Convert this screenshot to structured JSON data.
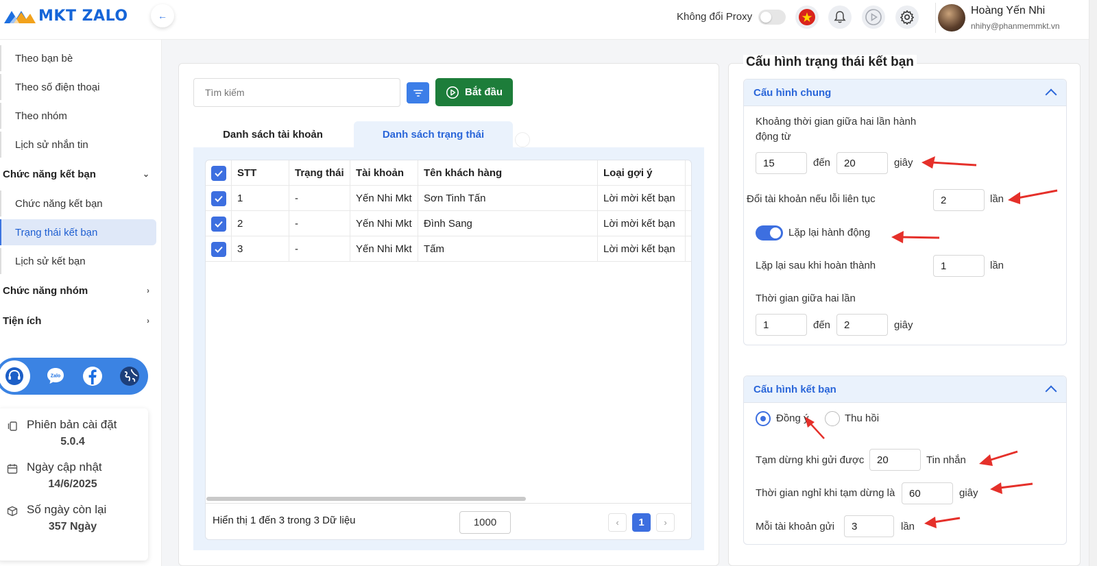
{
  "app": {
    "logo_text": "MKT ZALO"
  },
  "header": {
    "proxy_label": "Không đổi Proxy",
    "user_name": "Hoàng Yến Nhi",
    "user_email": "nhihy@phanmemmkt.vn",
    "icons": [
      "vietnam-flag-icon",
      "bell-icon",
      "play-icon",
      "gear-icon"
    ]
  },
  "sidebar": {
    "items_top": [
      "Theo bạn bè",
      "Theo số điện thoại",
      "Theo nhóm",
      "Lịch sử nhắn tin"
    ],
    "group_friend": "Chức năng kết bạn",
    "items_friend": [
      "Chức năng kết bạn",
      "Trạng thái kết bạn",
      "Lịch sử kết bạn"
    ],
    "active_item": "Trạng thái kết bạn",
    "group_group": "Chức năng nhóm",
    "group_util": "Tiện ích",
    "info": {
      "version_label": "Phiên bản cài đặt",
      "version_value": "5.0.4",
      "update_label": "Ngày cập nhật",
      "update_value": "14/6/2025",
      "days_label": "Số ngày còn lại",
      "days_value": "357 Ngày"
    }
  },
  "main": {
    "search_placeholder": "Tìm kiếm",
    "start_label": "Bắt đầu",
    "tabs": [
      "Danh sách tài khoản",
      "Danh sách trạng thái"
    ],
    "active_tab": "Danh sách trạng thái",
    "table": {
      "columns": [
        "STT",
        "Trạng thái",
        "Tài khoản",
        "Tên khách hàng",
        "Loại gợi ý"
      ],
      "rows": [
        {
          "stt": "1",
          "status": "-",
          "account": "Yến Nhi Mkt",
          "customer": "Sơn Tinh Tấn",
          "type": "Lời mời kết bạn"
        },
        {
          "stt": "2",
          "status": "-",
          "account": "Yến Nhi Mkt",
          "customer": "Đình Sang",
          "type": "Lời mời kết bạn"
        },
        {
          "stt": "3",
          "status": "-",
          "account": "Yến Nhi Mkt",
          "customer": "Tấm",
          "type": "Lời mời kết bạn"
        }
      ]
    },
    "footer_text": "Hiển thị 1 đến 3 trong 3 Dữ liệu",
    "page_size": "1000",
    "current_page": "1"
  },
  "config": {
    "title": "Cấu hình trạng thái kết bạn",
    "general": {
      "title": "Cấu hình chung",
      "interval_label_1": "Khoảng thời gian giữa hai lần hành",
      "interval_label_2": "động từ",
      "interval_from": "15",
      "to_label": "đến",
      "interval_to": "20",
      "seconds_label": "giây",
      "switch_label": "Đổi tài khoản nếu lỗi liên tục",
      "switch_value": "2",
      "times_label": "lần",
      "repeat_label": "Lặp lại hành động",
      "repeat_after_label": "Lặp lại sau khi hoàn thành",
      "repeat_after_value": "1",
      "between_label": "Thời gian giữa hai lần",
      "between_from": "1",
      "between_to": "2"
    },
    "friend": {
      "title": "Cấu hình kết bạn",
      "radio_accept": "Đồng ý",
      "radio_revoke": "Thu hồi",
      "selected": "Đồng ý",
      "pause_label": "Tạm dừng khi gửi được",
      "pause_value": "20",
      "pause_unit": "Tin nhắn",
      "rest_label": "Thời gian nghỉ khi tạm dừng là",
      "rest_value": "60",
      "rest_unit": "giây",
      "per_account_label": "Mỗi tài khoản gửi",
      "per_account_value": "3",
      "per_account_unit": "lần"
    }
  },
  "colors": {
    "brand_blue": "#1565d8",
    "accent_blue": "#3d6fe0",
    "start_green": "#1d7d3a",
    "annotation_red": "#e5302a"
  }
}
